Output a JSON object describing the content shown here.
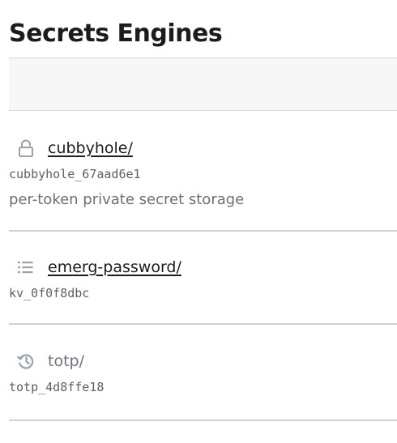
{
  "page": {
    "title": "Secrets Engines"
  },
  "engines": [
    {
      "name": "cubbyhole/",
      "accessor": "cubbyhole_67aad6e1",
      "description": "per-token private secret storage",
      "icon": "lock-icon",
      "link": true
    },
    {
      "name": "emerg-password/",
      "accessor": "kv_0f0f8dbc",
      "description": "",
      "icon": "list-icon",
      "link": true
    },
    {
      "name": "totp/",
      "accessor": "totp_4d8ffe18",
      "description": "",
      "icon": "history-icon",
      "link": false
    }
  ],
  "colors": {
    "divider": "#cdd0d6",
    "icon": "#9aa0a8",
    "toolbar_bg": "#f7f7f7"
  }
}
